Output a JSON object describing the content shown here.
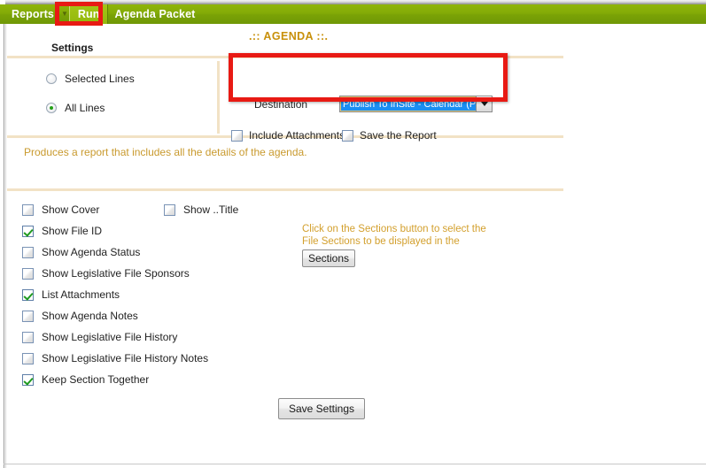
{
  "menubar": {
    "items": [
      {
        "label": "Reports",
        "active": false,
        "has_caret": true
      },
      {
        "label": "Run",
        "active": true,
        "has_caret": false
      },
      {
        "label": "Agenda Packet",
        "active": false,
        "has_caret": false
      }
    ],
    "background_color": "#83ab07"
  },
  "page": {
    "settings_heading": "Settings",
    "agenda_title": ".:: AGENDA ::.",
    "description": "Produces a report that includes all the details of the agenda.",
    "title_color": "#c8900a",
    "description_color": "#c99a2e"
  },
  "lines_options": {
    "selected_lines": {
      "label": "Selected Lines",
      "checked": false
    },
    "all_lines": {
      "label": "All Lines",
      "checked": true
    }
  },
  "destination": {
    "label": "Destination",
    "value": "Publish To InSite - Calendar (PDF)",
    "highlight_color": "#1b8ef2",
    "dropdown_icon": "chevron-down-icon"
  },
  "output_options": [
    {
      "label": "Include Attachments",
      "checked": false
    },
    {
      "label": "Save the Report",
      "checked": false
    }
  ],
  "report_options": [
    {
      "label": "Show Cover",
      "checked": false
    },
    {
      "label": "Show File ID",
      "checked": true
    },
    {
      "label": "Show Agenda Status",
      "checked": false
    },
    {
      "label": "Show Legislative File Sponsors",
      "checked": false
    },
    {
      "label": "List Attachments",
      "checked": true
    },
    {
      "label": "Show Agenda Notes",
      "checked": false
    },
    {
      "label": "Show Legislative File History",
      "checked": false
    },
    {
      "label": "Show Legislative File History Notes",
      "checked": false
    },
    {
      "label": "Keep Section Together",
      "checked": true
    }
  ],
  "title_option": {
    "label": "Show ..Title",
    "checked": false
  },
  "sections": {
    "help_text": "Click on the Sections button to select the File Sections to be displayed in the report.",
    "button_label": "Sections"
  },
  "footer": {
    "save_button_label": "Save Settings"
  },
  "annotations": {
    "color": "#e81a14",
    "boxes": [
      "run-menu-highlight",
      "destination-highlight"
    ]
  }
}
